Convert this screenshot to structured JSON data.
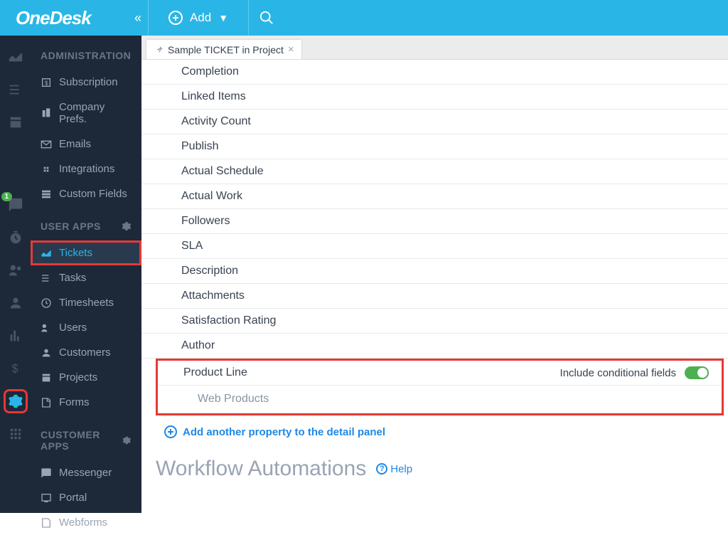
{
  "header": {
    "brand": "OneDesk",
    "add_label": "Add"
  },
  "tab": {
    "label": "Sample TICKET in Project"
  },
  "admin_sections": {
    "admin_label": "ADMINISTRATION",
    "user_apps_label": "USER APPS",
    "customer_apps_label": "CUSTOMER APPS"
  },
  "admin_items": {
    "subscription": "Subscription",
    "company_prefs": "Company Prefs.",
    "emails": "Emails",
    "integrations": "Integrations",
    "custom_fields": "Custom Fields",
    "tickets": "Tickets",
    "tasks": "Tasks",
    "timesheets": "Timesheets",
    "users": "Users",
    "customers": "Customers",
    "projects": "Projects",
    "forms": "Forms",
    "messenger": "Messenger",
    "portal": "Portal",
    "webforms": "Webforms"
  },
  "rail_badge": "1",
  "fields": {
    "completion": "Completion",
    "linked_items": "Linked Items",
    "activity_count": "Activity Count",
    "publish": "Publish",
    "actual_schedule": "Actual Schedule",
    "actual_work": "Actual Work",
    "followers": "Followers",
    "sla": "SLA",
    "description": "Description",
    "attachments": "Attachments",
    "satisfaction": "Satisfaction Rating",
    "author": "Author",
    "product_line": "Product Line",
    "cond_label": "Include conditional fields",
    "web_products": "Web Products"
  },
  "add_prop": "Add another property to the detail panel",
  "workflow": {
    "title": "Workflow Automations",
    "help": "Help"
  }
}
